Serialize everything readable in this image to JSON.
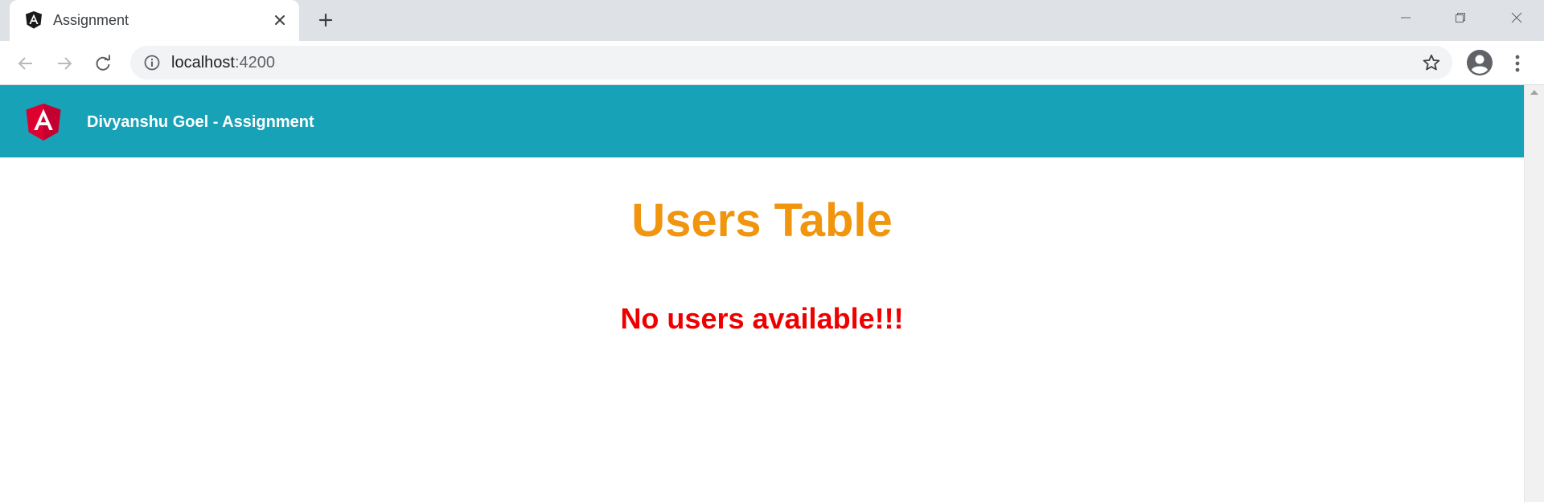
{
  "browser": {
    "tab": {
      "title": "Assignment"
    },
    "address_bar": {
      "host": "localhost",
      "port": ":4200"
    }
  },
  "app": {
    "header_title": "Divyanshu Goel - Assignment",
    "page_title": "Users Table",
    "empty_message": "No users available!!!"
  },
  "colors": {
    "header_bg": "#17a2b8",
    "title_color": "#f0950d",
    "message_color": "#ee0000",
    "angular_red": "#dd0031"
  },
  "icons": [
    "angular-icon",
    "close-icon",
    "plus-icon",
    "minimize-icon",
    "restore-icon",
    "close-window-icon",
    "back-arrow-icon",
    "forward-arrow-icon",
    "reload-icon",
    "info-icon",
    "star-icon",
    "profile-icon",
    "more-vert-icon",
    "chevron-up-icon"
  ]
}
